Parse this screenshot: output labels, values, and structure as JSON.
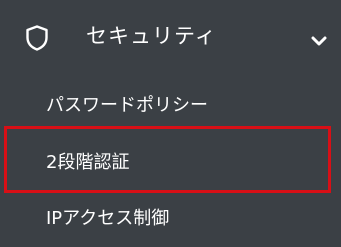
{
  "sidebar": {
    "section": {
      "label": "セキュリティ",
      "icon": "shield-icon",
      "expand_icon": "chevron-down-icon",
      "items": [
        {
          "label": "パスワードポリシー"
        },
        {
          "label": "2段階認証"
        },
        {
          "label": "IPアクセス制御"
        }
      ]
    }
  },
  "highlight": {
    "target": "2段階認証",
    "color": "#d80f16"
  },
  "colors": {
    "background": "#3b4045",
    "text": "#ffffff",
    "highlight": "#d80f16"
  }
}
